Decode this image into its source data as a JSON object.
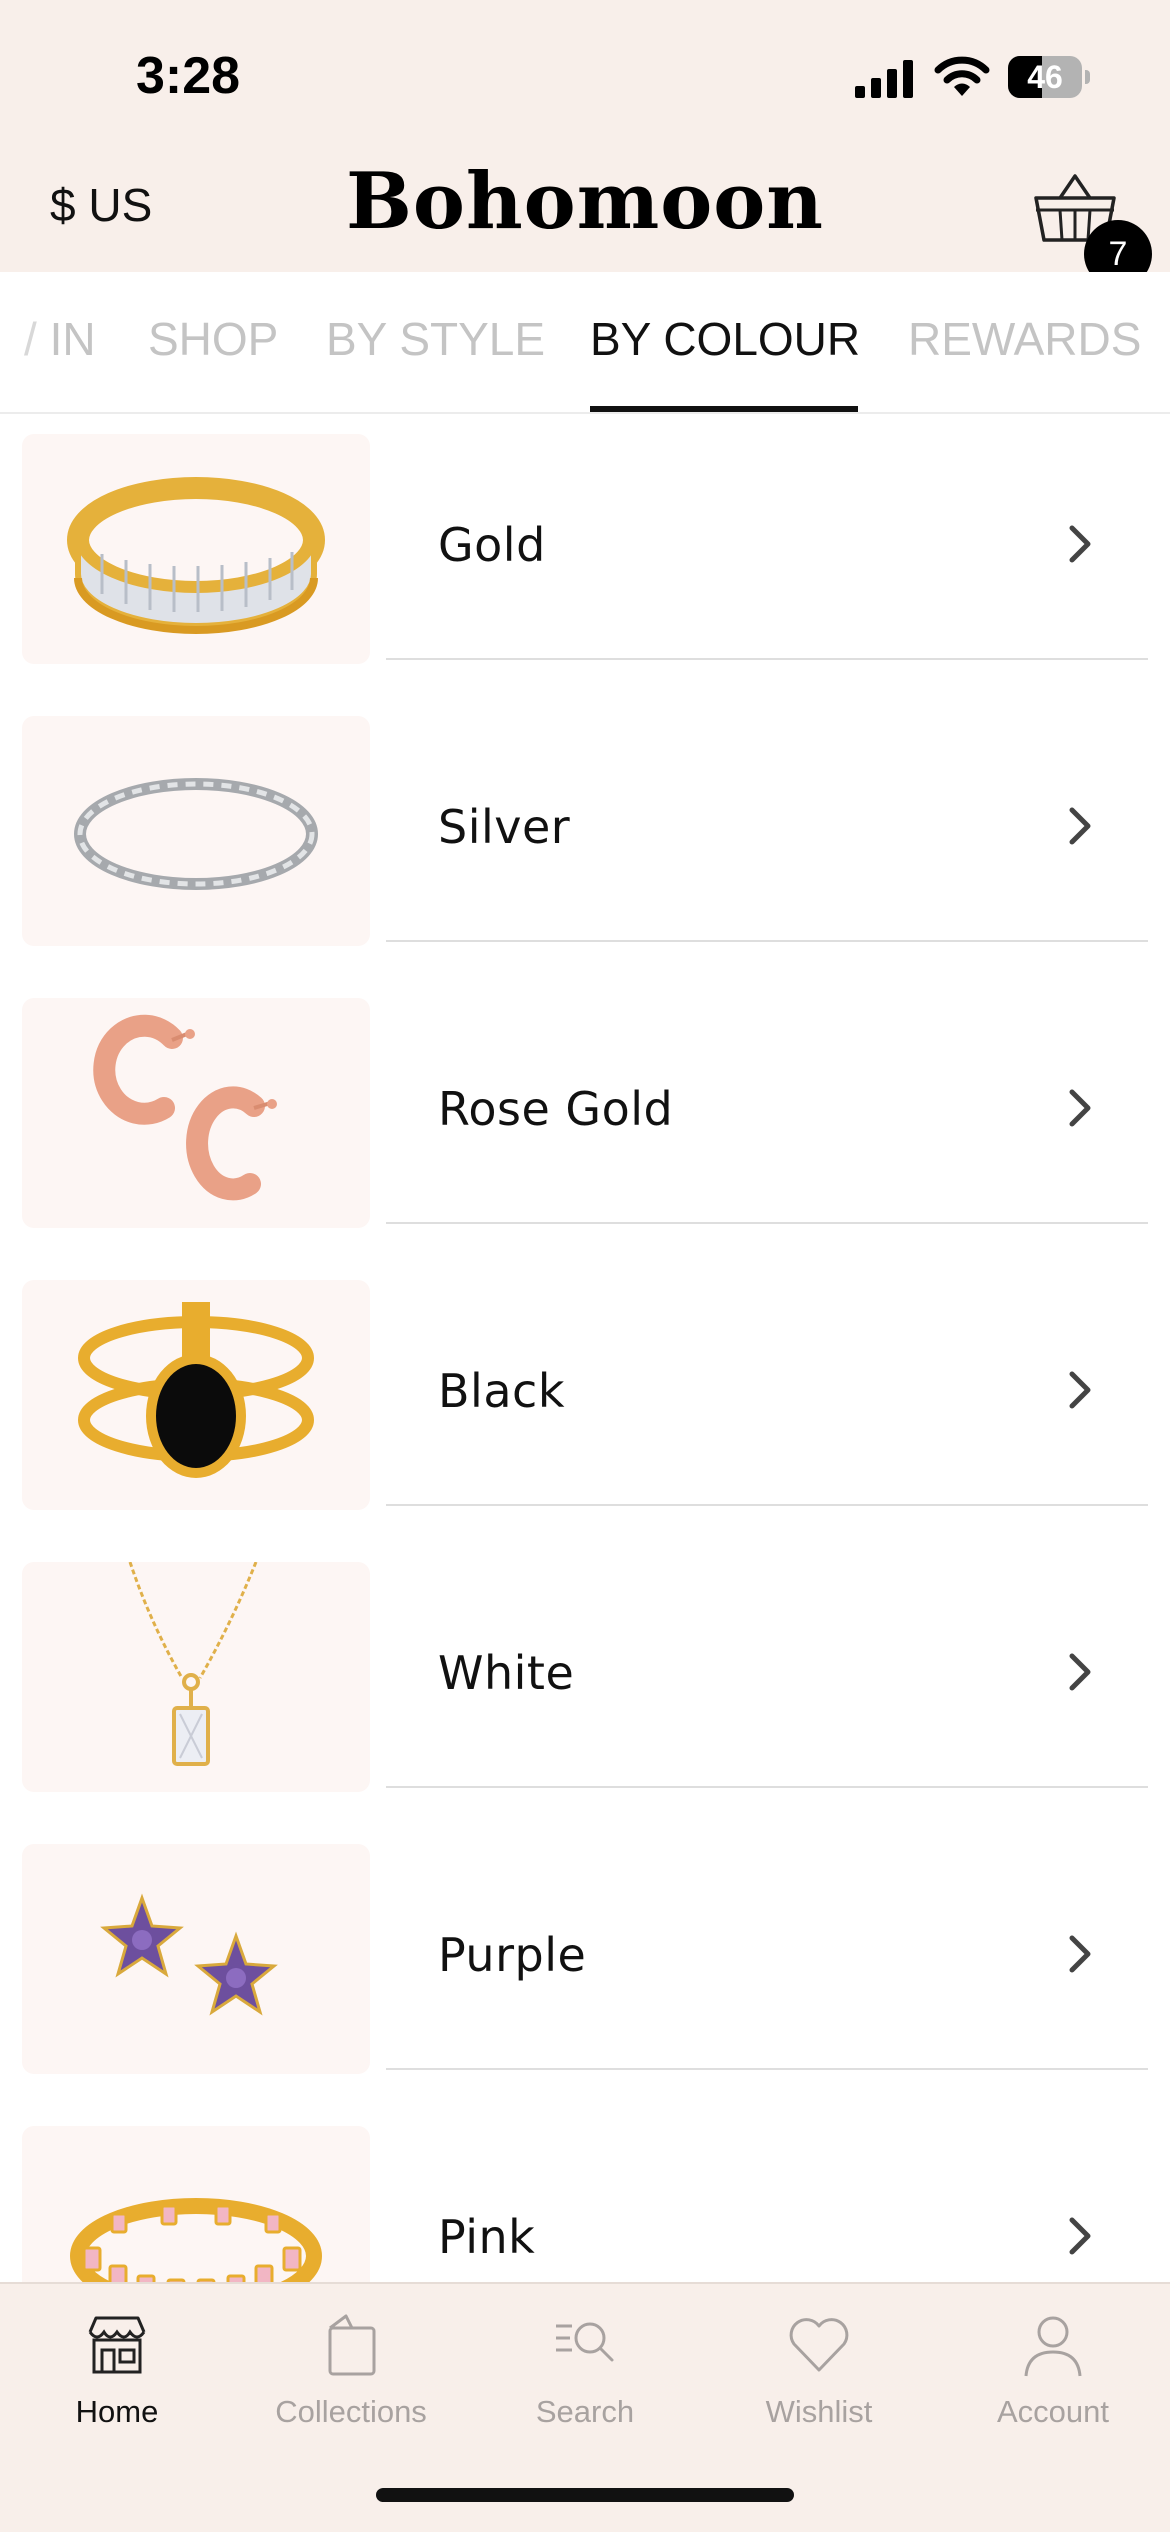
{
  "status_bar": {
    "time": "3:28",
    "battery_level": "46"
  },
  "header": {
    "currency": "$ US",
    "brand": "Bohomoon",
    "cart_count": "7"
  },
  "tabs": [
    {
      "label": "IN",
      "active": false
    },
    {
      "label": "SHOP",
      "active": false
    },
    {
      "label": "BY STYLE",
      "active": false
    },
    {
      "label": "BY COLOUR",
      "active": true
    },
    {
      "label": "REWARDS",
      "active": false
    }
  ],
  "colours": [
    {
      "label": "Gold",
      "thumb": "gold-ring"
    },
    {
      "label": "Silver",
      "thumb": "silver-bangle"
    },
    {
      "label": "Rose Gold",
      "thumb": "rose-gold-hoops"
    },
    {
      "label": "Black",
      "thumb": "black-stone-ring"
    },
    {
      "label": "White",
      "thumb": "white-pendant-necklace"
    },
    {
      "label": "Purple",
      "thumb": "purple-star-earrings"
    },
    {
      "label": "Pink",
      "thumb": "pink-stone-ring"
    }
  ],
  "tabbar": [
    {
      "label": "Home",
      "icon": "store-icon",
      "active": true
    },
    {
      "label": "Collections",
      "icon": "collections-icon",
      "active": false
    },
    {
      "label": "Search",
      "icon": "search-icon",
      "active": false
    },
    {
      "label": "Wishlist",
      "icon": "heart-icon",
      "active": false
    },
    {
      "label": "Account",
      "icon": "account-icon",
      "active": false
    }
  ],
  "colors": {
    "header_bg": "#f8efea",
    "thumb_bg": "#fdf6f4",
    "inactive_tab": "#c4c4c4",
    "active_tab": "#111111",
    "inactive_nav": "#a8a2a0"
  }
}
